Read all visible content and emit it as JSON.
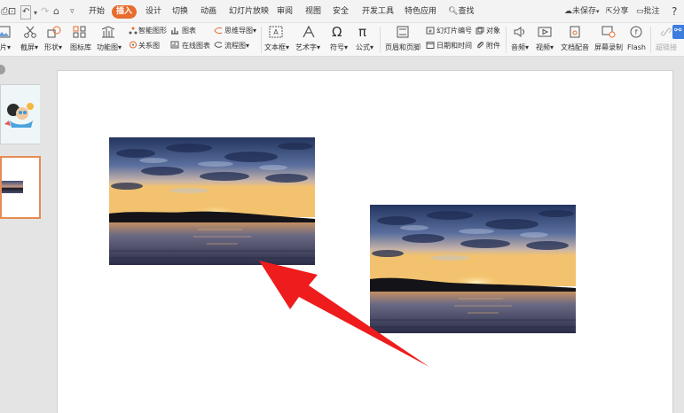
{
  "menu": {
    "tabs": [
      "开始",
      "插入",
      "设计",
      "切换",
      "动画",
      "幻灯片放映",
      "审阅",
      "视图",
      "安全",
      "开发工具",
      "特色应用"
    ],
    "active_tab": "插入",
    "search": "查找",
    "unsaved": "未保存",
    "share": "分享",
    "comment": "批注",
    "help": "?"
  },
  "ribbon": {
    "picture": "片",
    "screenshot": "截屏",
    "shape": "形状",
    "icon_lib": "图标库",
    "func_chart": "功能图",
    "smart_art": "智能图形",
    "chart": "图表",
    "mind_map": "思维导图",
    "relation": "关系图",
    "online_chart": "在线图表",
    "flowchart": "流程图",
    "textbox": "文本框",
    "art_text": "艺术字",
    "symbol": "符号",
    "formula": "公式",
    "header_footer": "页眉和页脚",
    "slide_number": "幻灯片编号",
    "object": "对象",
    "datetime": "日期和时间",
    "attachment": "附件",
    "audio": "音频",
    "video": "视频",
    "doc_dub": "文档配音",
    "screen_rec": "屏幕录制",
    "flash": "Flash",
    "hyperlink": "超链接"
  },
  "colors": {
    "accent": "#e76c2e",
    "thumb_border": "#e78b54",
    "arrow": "#ee1c1c"
  }
}
